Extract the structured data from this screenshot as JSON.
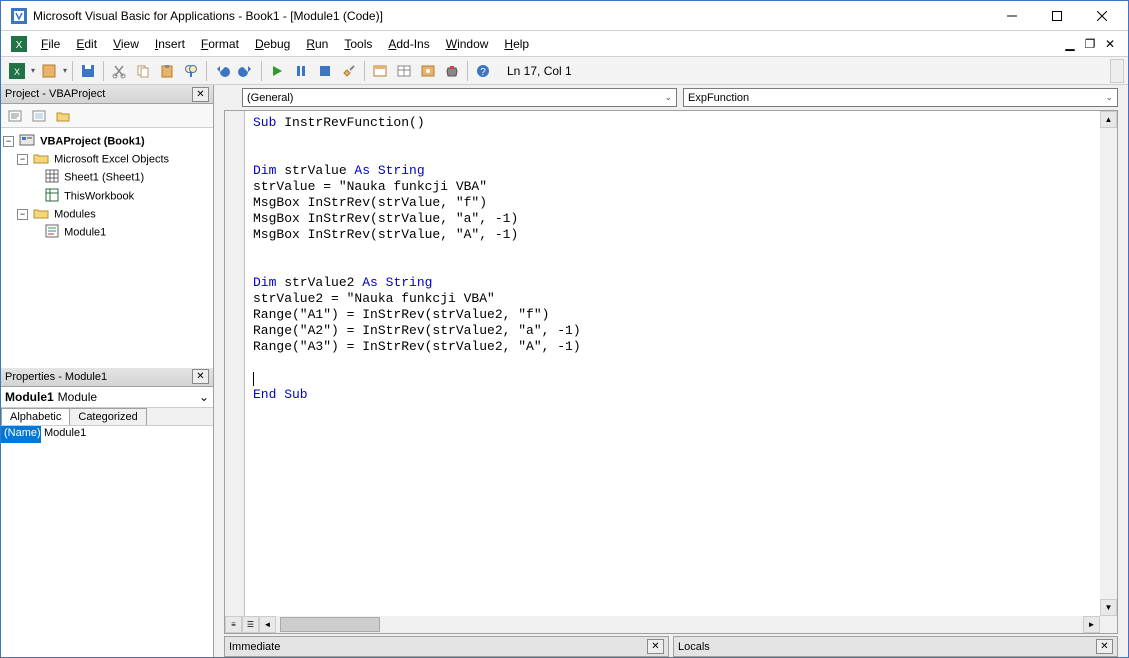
{
  "title": "Microsoft Visual Basic for Applications - Book1 - [Module1 (Code)]",
  "menu": {
    "items": [
      "File",
      "Edit",
      "View",
      "Insert",
      "Format",
      "Debug",
      "Run",
      "Tools",
      "Add-Ins",
      "Window",
      "Help"
    ]
  },
  "status": {
    "position": "Ln 17, Col 1"
  },
  "project_panel": {
    "title": "Project - VBAProject",
    "root": "VBAProject (Book1)",
    "folder_objects": "Microsoft Excel Objects",
    "sheet1": "Sheet1 (Sheet1)",
    "thiswb": "ThisWorkbook",
    "folder_modules": "Modules",
    "module1": "Module1"
  },
  "props_panel": {
    "title": "Properties - Module1",
    "obj_name": "Module1",
    "obj_type": "Module",
    "tab_alpha": "Alphabetic",
    "tab_cat": "Categorized",
    "row_name_label": "(Name)",
    "row_name_value": "Module1"
  },
  "code": {
    "combo_left": "(General)",
    "combo_right": "ExpFunction",
    "lines": [
      {
        "t": "plain",
        "pre": "Sub ",
        "mid": "InstrRevFunction()",
        "kw": true
      },
      {
        "t": "blank"
      },
      {
        "t": "blank"
      },
      {
        "t": "dim",
        "var": "strValue",
        "as": "String"
      },
      {
        "t": "plain",
        "txt": "strValue = \"Nauka funkcji VBA\""
      },
      {
        "t": "plain",
        "txt": "MsgBox InStrRev(strValue, \"f\")"
      },
      {
        "t": "plain",
        "txt": "MsgBox InStrRev(strValue, \"a\", -1)"
      },
      {
        "t": "plain",
        "txt": "MsgBox InStrRev(strValue, \"A\", -1)"
      },
      {
        "t": "blank"
      },
      {
        "t": "blank"
      },
      {
        "t": "dim",
        "var": "strValue2",
        "as": "String"
      },
      {
        "t": "plain",
        "txt": "strValue2 = \"Nauka funkcji VBA\""
      },
      {
        "t": "plain",
        "txt": "Range(\"A1\") = InStrRev(strValue2, \"f\")"
      },
      {
        "t": "plain",
        "txt": "Range(\"A2\") = InStrRev(strValue2, \"a\", -1)"
      },
      {
        "t": "plain",
        "txt": "Range(\"A3\") = InStrRev(strValue2, \"A\", -1)"
      },
      {
        "t": "blank"
      },
      {
        "t": "caret"
      },
      {
        "t": "kw",
        "txt": "End Sub"
      }
    ]
  },
  "bottom": {
    "immediate": "Immediate",
    "locals": "Locals"
  }
}
